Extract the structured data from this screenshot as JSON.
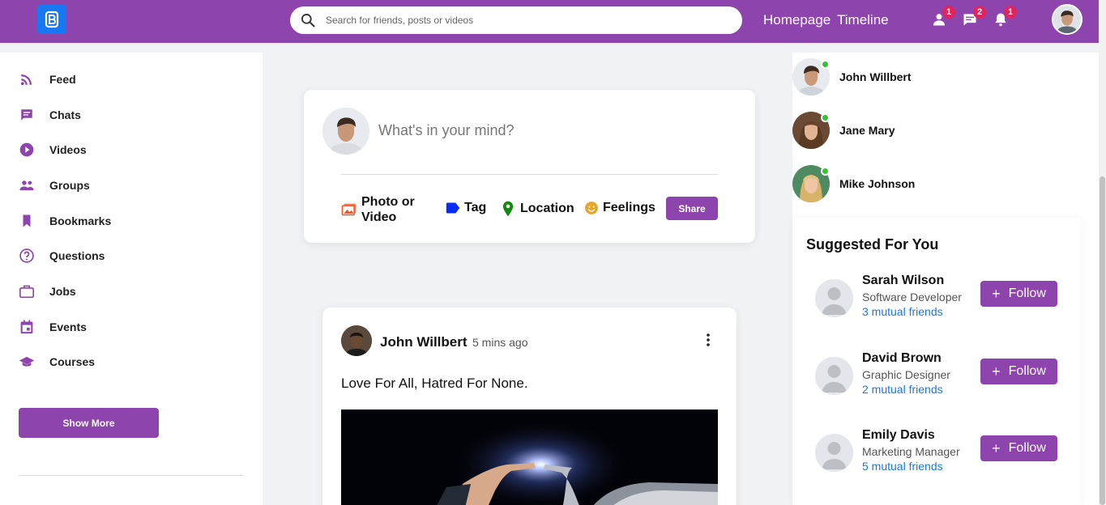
{
  "header": {
    "search_placeholder": "Search for friends, posts or videos",
    "nav": {
      "homepage": "Homepage",
      "timeline": "Timeline"
    },
    "badges": {
      "friends": "1",
      "messages": "2",
      "notifications": "1"
    },
    "icons": [
      "logo-icon",
      "search-icon",
      "person-icon",
      "chat-icon",
      "bell-icon"
    ],
    "color": "#8e44ad"
  },
  "sidebar": {
    "items": [
      {
        "label": "Feed",
        "icon": "rss-icon"
      },
      {
        "label": "Chats",
        "icon": "chat-icon"
      },
      {
        "label": "Videos",
        "icon": "play-icon"
      },
      {
        "label": "Groups",
        "icon": "group-icon"
      },
      {
        "label": "Bookmarks",
        "icon": "bookmark-icon"
      },
      {
        "label": "Questions",
        "icon": "question-icon"
      },
      {
        "label": "Jobs",
        "icon": "briefcase-icon"
      },
      {
        "label": "Events",
        "icon": "calendar-icon"
      },
      {
        "label": "Courses",
        "icon": "graduation-cap-icon"
      }
    ],
    "show_more": "Show More"
  },
  "composer": {
    "placeholder": "What's in your mind?",
    "options": {
      "photo_line1": "Photo or",
      "photo_line2": "Video",
      "tag": "Tag",
      "location": "Location",
      "feelings": "Feelings"
    },
    "share": "Share"
  },
  "post": {
    "author": "John Willbert",
    "time": "5 mins ago",
    "text": "Love For All, Hatred For None."
  },
  "online": [
    {
      "name": "John Willbert"
    },
    {
      "name": "Jane Mary"
    },
    {
      "name": "Mike Johnson"
    }
  ],
  "suggested": {
    "title": "Suggested For You",
    "follow_label": "Follow",
    "people": [
      {
        "name": "Sarah Wilson",
        "role": "Software Developer",
        "mutual": "3 mutual friends"
      },
      {
        "name": "David Brown",
        "role": "Graphic Designer",
        "mutual": "2 mutual friends"
      },
      {
        "name": "Emily Davis",
        "role": "Marketing Manager",
        "mutual": "5 mutual friends"
      }
    ]
  },
  "colors": {
    "accent": "#8e44ad",
    "link": "#1877f2",
    "online": "#31c631",
    "badge": "#e0245e"
  }
}
